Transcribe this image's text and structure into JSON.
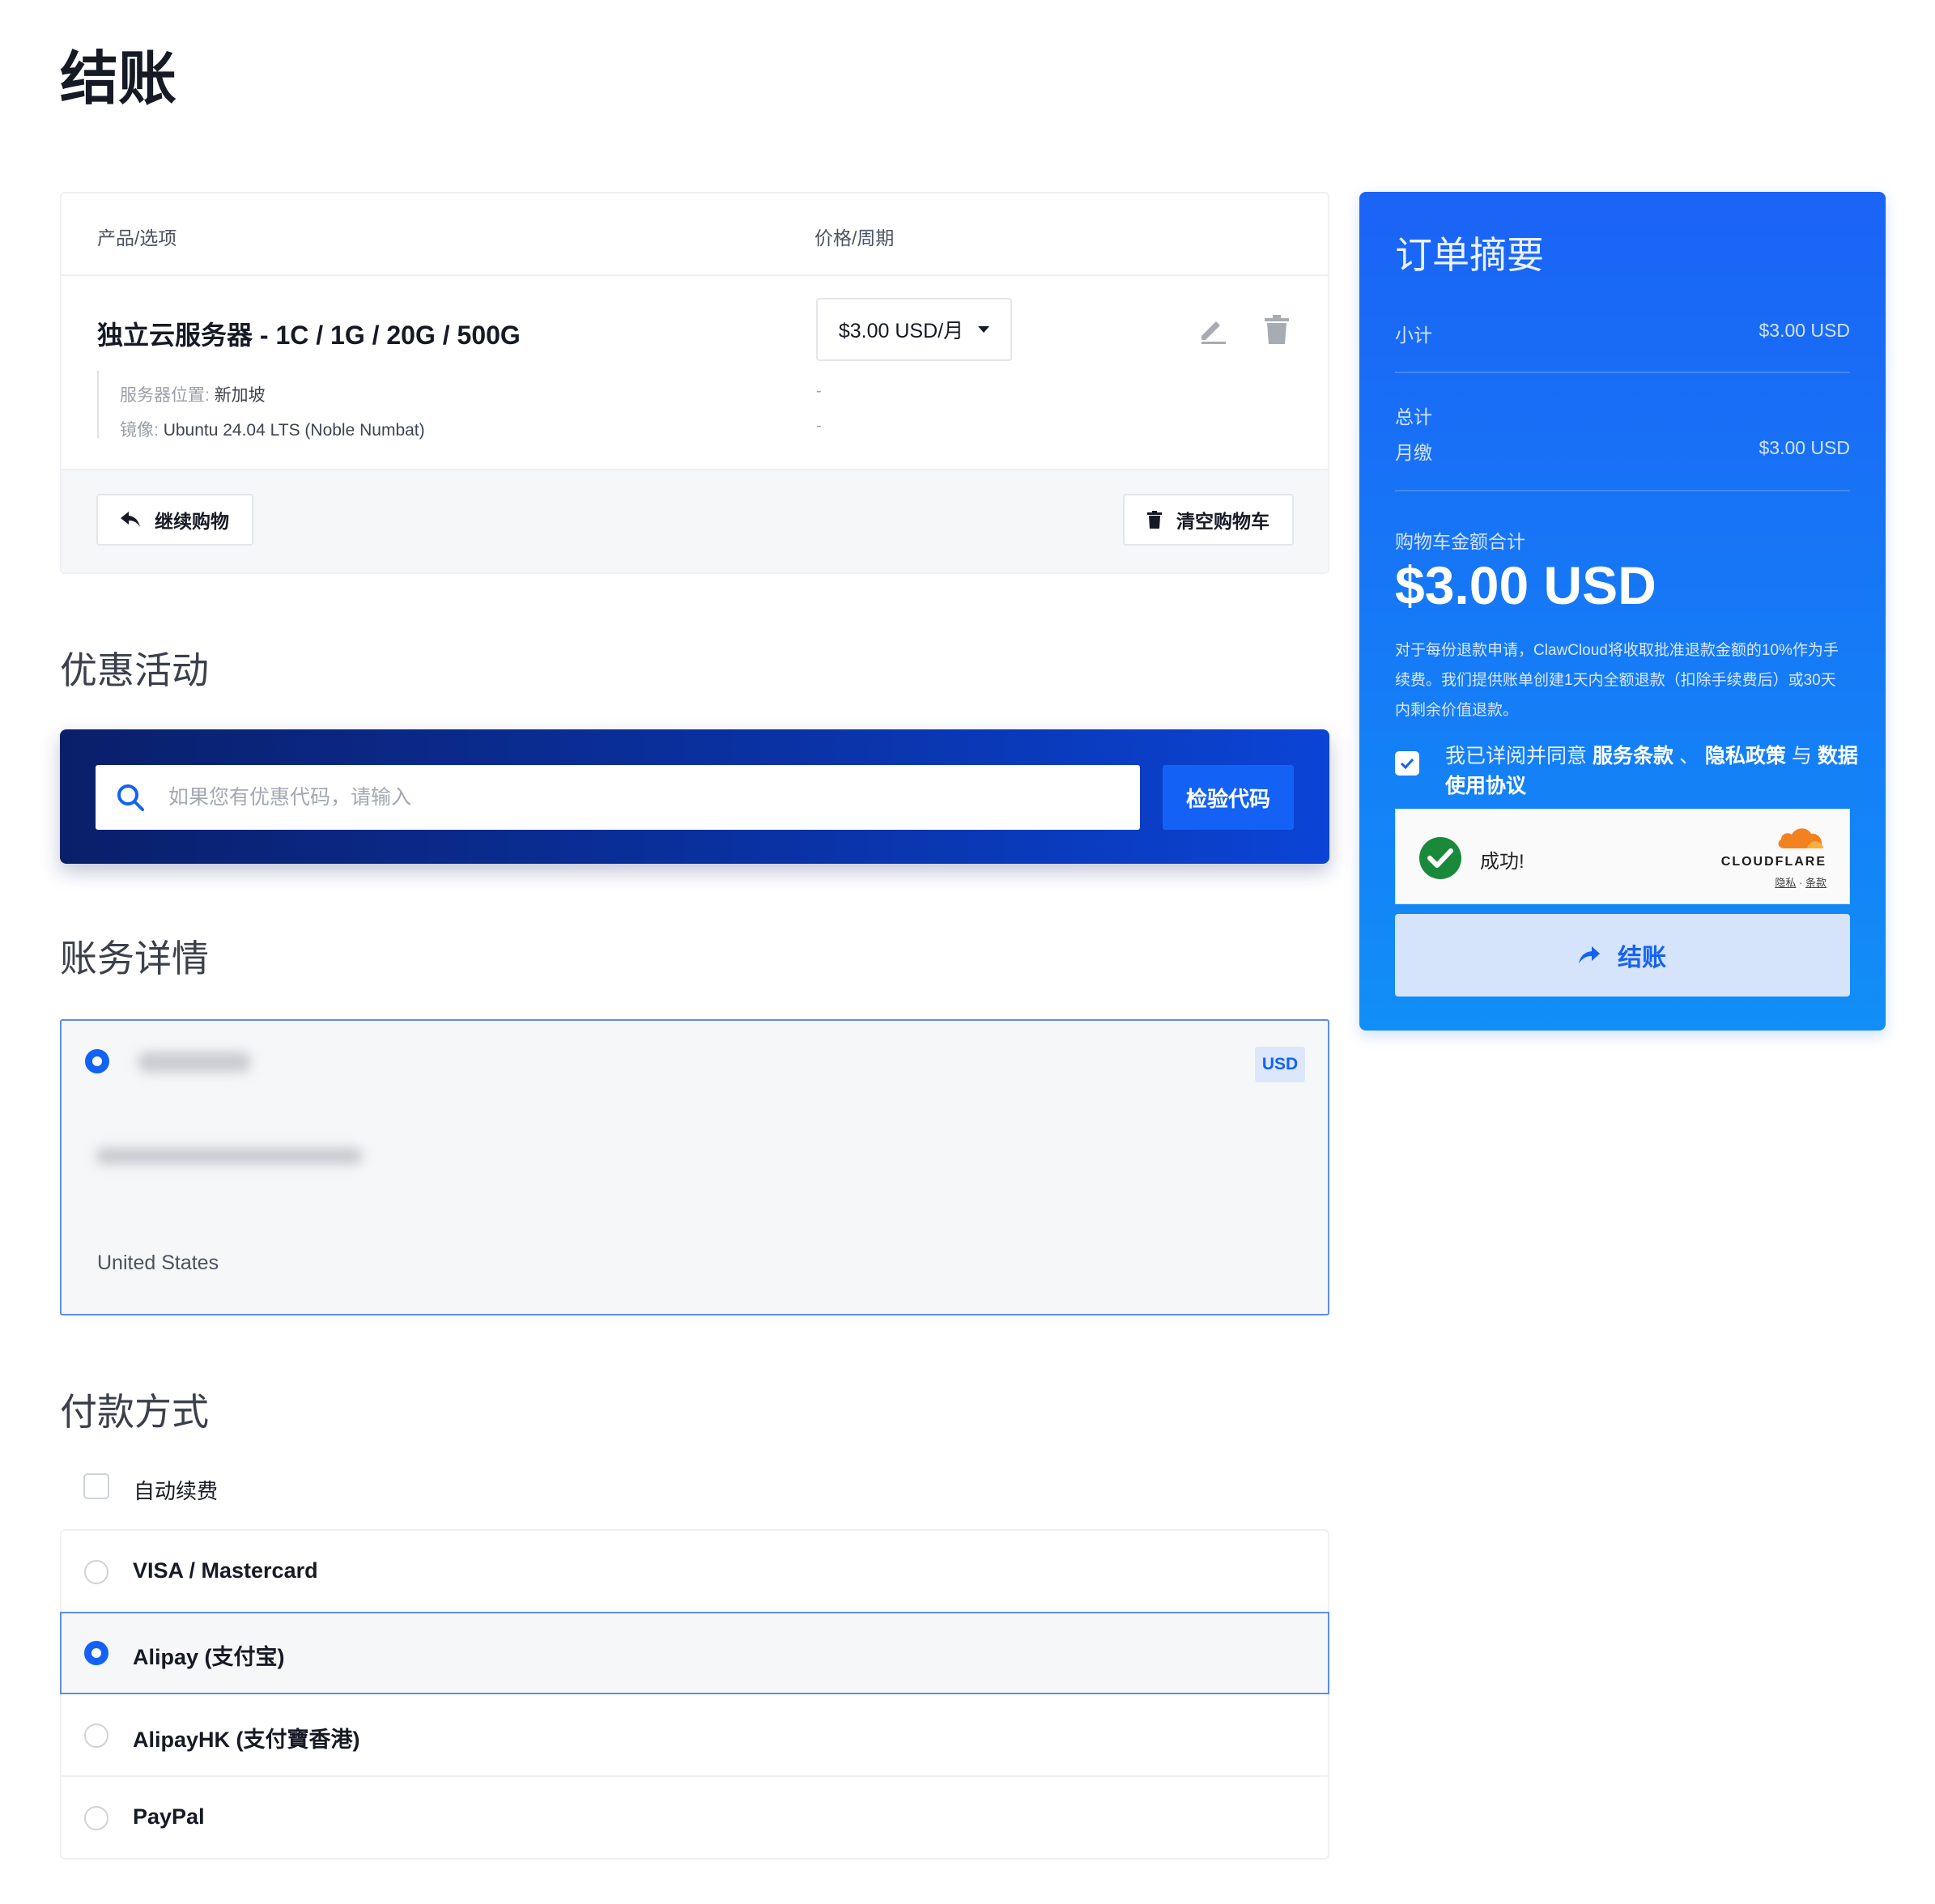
{
  "page": {
    "title": "结账"
  },
  "cart": {
    "columns": {
      "product": "产品/选项",
      "price": "价格/周期"
    },
    "item": {
      "name": "独立云服务器 - 1C / 1G / 20G / 500G",
      "price_cycle": "$3.00 USD/月",
      "options": [
        {
          "label": "服务器位置:",
          "value": "新加坡",
          "price": "-"
        },
        {
          "label": "镜像:",
          "value": "Ubuntu 24.04 LTS (Noble Numbat)",
          "price": "-"
        }
      ]
    },
    "continue_label": "继续购物",
    "empty_label": "清空购物车"
  },
  "promo": {
    "title": "优惠活动",
    "placeholder": "如果您有优惠代码，请输入",
    "validate_label": "检验代码"
  },
  "billing": {
    "title": "账务详情",
    "currency": "USD",
    "country": "United States"
  },
  "payment": {
    "title": "付款方式",
    "auto_renew_label": "自动续费",
    "methods": [
      {
        "label": "VISA / Mastercard",
        "selected": false
      },
      {
        "label": "Alipay (支付宝)",
        "selected": true
      },
      {
        "label": "AlipayHK (支付寶香港)",
        "selected": false
      },
      {
        "label": "PayPal",
        "selected": false
      }
    ]
  },
  "summary": {
    "title": "订单摘要",
    "subtotal_label": "小计",
    "subtotal_value": "$3.00 USD",
    "total_label": "总计",
    "monthly_label": "月缴",
    "monthly_value": "$3.00 USD",
    "cart_total_label": "购物车金额合计",
    "cart_total_value": "$3.00 USD",
    "refund_note": "对于每份退款申请，ClawCloud将收取批准退款金额的10%作为手续费。我们提供账单创建1天内全额退款（扣除手续费后）或30天内剩余价值退款。",
    "agree_prefix": "我已详阅并同意",
    "terms_link": "服务条款",
    "sep1": "、",
    "privacy_link": "隐私政策",
    "sep2": "与",
    "data_link": "数据使用协议",
    "agreed": true,
    "checkout_label": "结账"
  },
  "captcha": {
    "status": "成功!",
    "brand": "CLOUDFLARE",
    "privacy_link": "隐私",
    "dot": "·",
    "terms_link": "条款"
  },
  "colors": {
    "accent": "#1462f5",
    "promo_dark": "#0a1f6a",
    "success": "#1a8a3a",
    "cloudflare_orange": "#f48120"
  }
}
